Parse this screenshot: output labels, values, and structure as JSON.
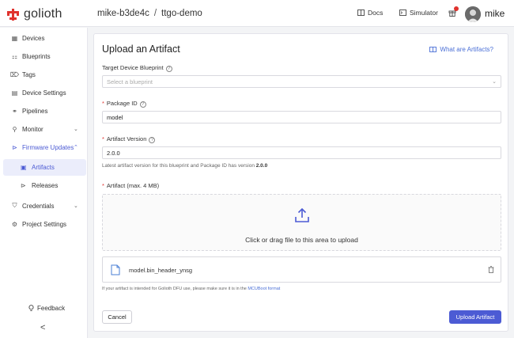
{
  "header": {
    "logo_text": "golioth",
    "breadcrumb": [
      "mike-b3de4c",
      "/",
      "ttgo-demo"
    ],
    "docs_label": "Docs",
    "simulator_label": "Simulator",
    "user_name": "mike",
    "icons": [
      "golioth-logo-icon",
      "book-icon",
      "terminal-icon",
      "gift-icon",
      "avatar"
    ],
    "accent_color": "#e0322d"
  },
  "sidebar": {
    "items": [
      {
        "label": "Devices",
        "icon": "devices-icon"
      },
      {
        "label": "Blueprints",
        "icon": "blueprint-icon"
      },
      {
        "label": "Tags",
        "icon": "tag-icon"
      },
      {
        "label": "Device Settings",
        "icon": "settings-icon"
      },
      {
        "label": "Pipelines",
        "icon": "pipeline-icon"
      },
      {
        "label": "Monitor",
        "icon": "search-icon"
      },
      {
        "label": "Firmware Updates",
        "icon": "firmware-icon"
      },
      {
        "label": "Credentials",
        "icon": "shield-icon"
      },
      {
        "label": "Project Settings",
        "icon": "gear-icon"
      }
    ],
    "subitems": [
      {
        "label": "Artifacts",
        "icon": "file-icon"
      },
      {
        "label": "Releases",
        "icon": "send-icon"
      }
    ],
    "feedback_label": "Feedback",
    "collapse_label": "<",
    "active_color": "#4c5bd4"
  },
  "form": {
    "title": "Upload an Artifact",
    "help_link": "What are Artifacts?",
    "blueprint_label": "Target Device Blueprint",
    "blueprint_placeholder": "Select a blueprint",
    "package_label": "Package ID",
    "package_value": "model",
    "version_label": "Artifact Version",
    "version_value": "2.0.0",
    "version_note_prefix": "Latest artifact version for this blueprint and Package ID has version",
    "version_note_value": "2.0.0",
    "artifact_label": "Artifact (max. 4 MB)",
    "drop_text": "Click or drag file to this area to upload",
    "file_name": "model.bin_header_ynsg",
    "hint_prefix": "If your artifact is intended for Golioth DFU use, please make sure it is in the",
    "hint_link": "MCUBoot format",
    "cancel_label": "Cancel",
    "upload_label": "Upload Artifact",
    "primary_color": "#4c5bd4"
  }
}
